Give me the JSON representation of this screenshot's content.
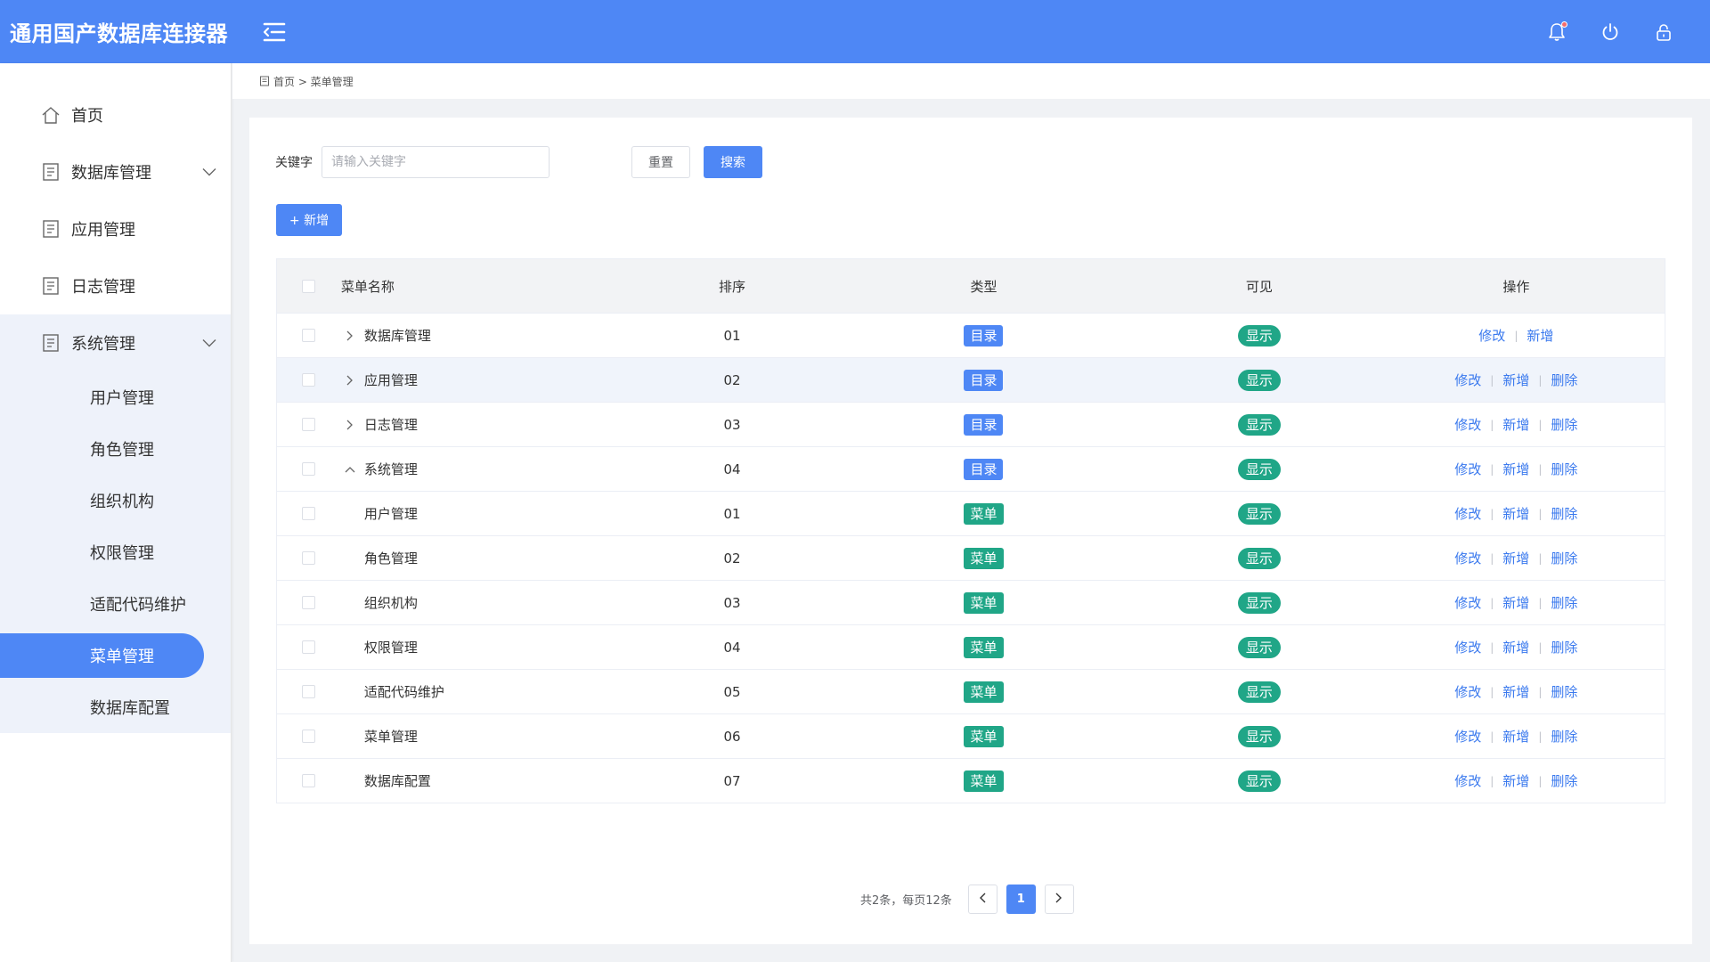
{
  "colors": {
    "primary": "#4e87f5",
    "success": "#20a687",
    "link": "#3a79ee"
  },
  "header": {
    "title": "通用国产数据库连接器"
  },
  "sidebar": {
    "items": [
      {
        "label": "首页",
        "icon": "home-icon"
      },
      {
        "label": "数据库管理",
        "icon": "document-icon"
      },
      {
        "label": "应用管理",
        "icon": "document-icon"
      },
      {
        "label": "日志管理",
        "icon": "document-icon"
      },
      {
        "label": "系统管理",
        "icon": "document-icon"
      }
    ],
    "submenu": [
      {
        "label": "用户管理"
      },
      {
        "label": "角色管理"
      },
      {
        "label": "组织机构"
      },
      {
        "label": "权限管理"
      },
      {
        "label": "适配代码维护"
      },
      {
        "label": "菜单管理",
        "active": true
      },
      {
        "label": "数据库配置"
      }
    ]
  },
  "breadcrumb": {
    "text": "首页 > 菜单管理"
  },
  "search": {
    "label": "关键字",
    "placeholder": "请输入关键字",
    "value": "",
    "reset_label": "重置",
    "search_label": "搜索"
  },
  "toolbar": {
    "add_label": "+ 新增"
  },
  "table": {
    "headers": {
      "name": "菜单名称",
      "sort": "排序",
      "type": "类型",
      "visible": "可见",
      "ops": "操作"
    },
    "rows": [
      {
        "name": "数据库管理",
        "sort": "01",
        "type": "目录",
        "visible": "显示",
        "edit": "修改",
        "add": "新增",
        "del": ""
      },
      {
        "name": "应用管理",
        "sort": "02",
        "type": "目录",
        "visible": "显示",
        "edit": "修改",
        "add": "新增",
        "del": "删除"
      },
      {
        "name": "日志管理",
        "sort": "03",
        "type": "目录",
        "visible": "显示",
        "edit": "修改",
        "add": "新增",
        "del": "删除"
      },
      {
        "name": "系统管理",
        "sort": "04",
        "type": "目录",
        "visible": "显示",
        "edit": "修改",
        "add": "新增",
        "del": "删除"
      },
      {
        "name": "用户管理",
        "sort": "01",
        "type": "菜单",
        "visible": "显示",
        "edit": "修改",
        "add": "新增",
        "del": "删除"
      },
      {
        "name": "角色管理",
        "sort": "02",
        "type": "菜单",
        "visible": "显示",
        "edit": "修改",
        "add": "新增",
        "del": "删除"
      },
      {
        "name": "组织机构",
        "sort": "03",
        "type": "菜单",
        "visible": "显示",
        "edit": "修改",
        "add": "新增",
        "del": "删除"
      },
      {
        "name": "权限管理",
        "sort": "04",
        "type": "菜单",
        "visible": "显示",
        "edit": "修改",
        "add": "新增",
        "del": "删除"
      },
      {
        "name": "适配代码维护",
        "sort": "05",
        "type": "菜单",
        "visible": "显示",
        "edit": "修改",
        "add": "新增",
        "del": "删除"
      },
      {
        "name": "菜单管理",
        "sort": "06",
        "type": "菜单",
        "visible": "显示",
        "edit": "修改",
        "add": "新增",
        "del": "删除"
      },
      {
        "name": "数据库配置",
        "sort": "07",
        "type": "菜单",
        "visible": "显示",
        "edit": "修改",
        "add": "新增",
        "del": "删除"
      }
    ]
  },
  "pagination": {
    "summary": "共2条，每页12条",
    "current": "1"
  }
}
